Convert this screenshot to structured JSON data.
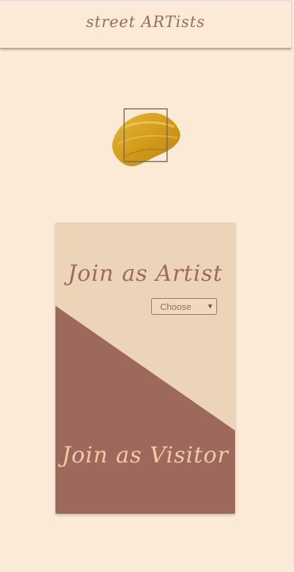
{
  "header": {
    "title": "street ARTists"
  },
  "logo": {
    "icon": "paint-brush-stroke-icon",
    "color": "#d4a021"
  },
  "join": {
    "artist_label": "Join as Artist",
    "artist_select": {
      "selected": "Choose"
    },
    "visitor_label": "Join as Visitor"
  },
  "colors": {
    "background": "#fbead6",
    "card_top": "#ecd4b8",
    "card_bottom": "#9e695d",
    "text_accent": "#9c6a5e",
    "visitor_text": "#f4c9a5"
  }
}
